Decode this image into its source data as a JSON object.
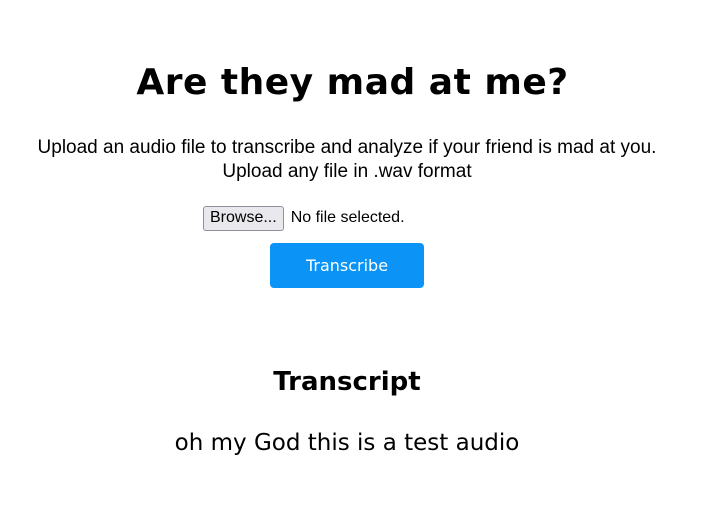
{
  "header": {
    "title": "Are they mad at me?"
  },
  "intro": {
    "line1": "Upload an audio file to transcribe and analyze if your friend is mad at you.",
    "line2": "Upload any file in .wav format"
  },
  "upload": {
    "browse_label": "Browse...",
    "file_status": "No file selected."
  },
  "actions": {
    "transcribe_label": "Transcribe"
  },
  "transcript": {
    "heading": "Transcript",
    "text": "oh my God this is a test audio"
  },
  "colors": {
    "accent": "#0b93f6",
    "text": "#000000",
    "background": "#ffffff"
  }
}
